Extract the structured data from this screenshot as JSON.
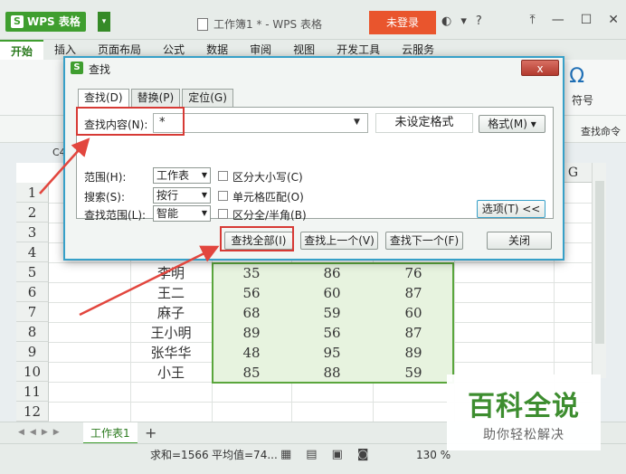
{
  "app": {
    "logo": "WPS 表格",
    "doc_title": "工作簿1 * - WPS 表格",
    "login": "未登录"
  },
  "ribbon": {
    "tabs": [
      "开始",
      "插入",
      "页面布局",
      "公式",
      "数据",
      "审阅",
      "视图",
      "开发工具",
      "云服务"
    ],
    "fuhao": "符号",
    "find_cmd": "查找命令",
    "name_box": "C4"
  },
  "sheet": {
    "rows": [
      "1",
      "2",
      "3",
      "4",
      "5",
      "6",
      "7",
      "8",
      "9",
      "10",
      "11",
      "12"
    ],
    "col_g": "G",
    "data": [
      {
        "name": "李明",
        "b": "35",
        "c": "86",
        "d": "76"
      },
      {
        "name": "王二",
        "b": "56",
        "c": "60",
        "d": "87"
      },
      {
        "name": "麻子",
        "b": "68",
        "c": "59",
        "d": "60"
      },
      {
        "name": "王小明",
        "b": "89",
        "c": "56",
        "d": "87"
      },
      {
        "name": "张华华",
        "b": "48",
        "c": "95",
        "d": "89"
      },
      {
        "name": "小王",
        "b": "85",
        "c": "88",
        "d": "59"
      }
    ],
    "tab": "工作表1"
  },
  "status": {
    "sum": "求和=1566",
    "avg": "平均值=74...",
    "zoom": "130 %"
  },
  "dialog": {
    "title": "查找",
    "close": "x",
    "tabs": [
      "查找(D)",
      "替换(P)",
      "定位(G)"
    ],
    "find_label": "查找内容(N):",
    "find_value": "*",
    "format_state": "未设定格式",
    "format_btn": "格式(M)",
    "range_label": "范围(H):",
    "range_value": "工作表",
    "search_label": "搜索(S):",
    "search_value": "按行",
    "scope_label": "查找范围(L):",
    "scope_value": "智能",
    "opt_case": "区分大小写(C)",
    "opt_cell": "单元格匹配(O)",
    "opt_width": "区分全/半角(B)",
    "options_btn": "选项(T) <<",
    "find_all": "查找全部(I)",
    "find_prev": "查找上一个(V)",
    "find_next": "查找下一个(F)",
    "close_btn": "关闭"
  },
  "watermark": {
    "title": "百科全说",
    "sub": "助你轻松解决"
  },
  "colors": {
    "accent": "#3f9e2f",
    "highlight": "#d73a35",
    "selection": "#e7f3df"
  }
}
